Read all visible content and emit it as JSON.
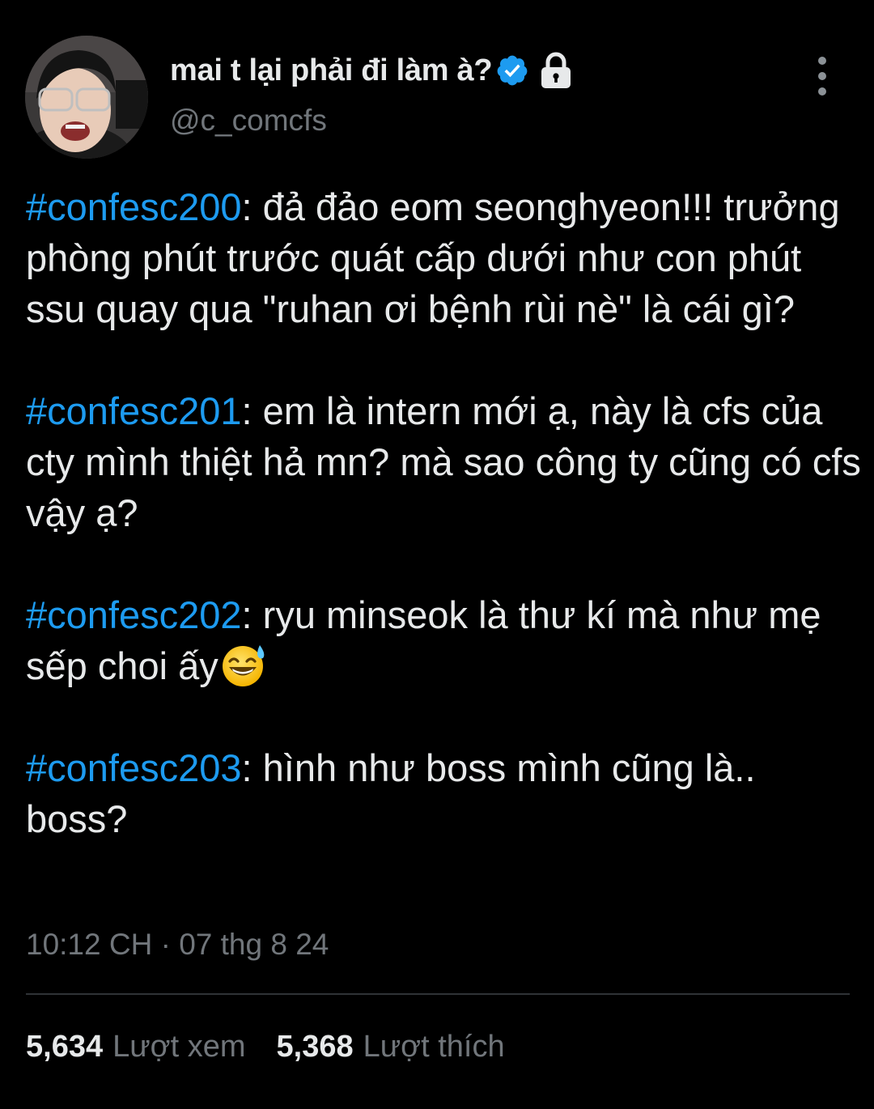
{
  "author": {
    "display_name": "mai t lại phải đi làm à?",
    "handle": "@c_comcfs",
    "verified": true,
    "protected": true,
    "avatar_icon": "avatar-photo",
    "verified_icon": "verified-badge-icon",
    "lock_icon": "lock-icon"
  },
  "menu": {
    "icon": "more-vertical-icon"
  },
  "tweet": {
    "paragraphs": [
      {
        "hashtag": "#confesc200",
        "text": ": đả đảo eom seonghyeon!!! trưởng phòng phút trước quát cấp dưới như con phút ssu quay qua \"ruhan ơi bệnh rùi nè\" là cái gì?"
      },
      {
        "hashtag": "#confesc201",
        "text": ": em là intern mới ạ, này là cfs của cty mình thiệt hả mn? mà sao công ty cũng có cfs vậy ạ?"
      },
      {
        "hashtag": "#confesc202",
        "text": ": ryu minseok là thư kí mà như mẹ sếp choi ấy",
        "emoji": "grinning-face-with-sweat-emoji"
      },
      {
        "hashtag": "#confesc203",
        "text": ": hình như boss mình cũng là.. boss?"
      }
    ],
    "timestamp": "10:12 CH · 07 thg 8 24"
  },
  "stats": {
    "views_value": "5,634",
    "views_label": "Lượt xem",
    "likes_value": "5,368",
    "likes_label": "Lượt thích"
  },
  "colors": {
    "background": "#000000",
    "text": "#e7e9ea",
    "secondary_text": "#71767b",
    "hashtag": "#1d9bf0",
    "verified": "#1d9bf0",
    "divider": "#2f3336"
  }
}
